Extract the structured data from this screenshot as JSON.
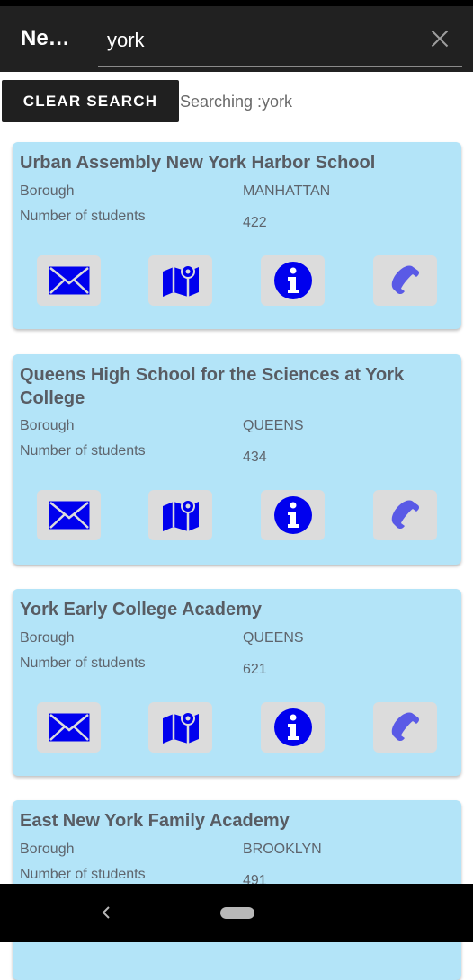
{
  "appbar": {
    "title": "Ne…",
    "search_value": "york"
  },
  "toolbar": {
    "clear_label": "CLEAR SEARCH",
    "status_text": "Searching :york"
  },
  "labels": {
    "borough": "Borough",
    "students": "Number of students"
  },
  "colors": {
    "card_bg": "#b3e4f8",
    "icon_blue": "#0000ee",
    "phone_blue": "#5a5ae6"
  },
  "schools": [
    {
      "name": "Urban Assembly New York Harbor School",
      "borough": "MANHATTAN",
      "students": "422"
    },
    {
      "name": "Queens High School for the Sciences at York College",
      "borough": "QUEENS",
      "students": "434"
    },
    {
      "name": "York Early College Academy",
      "borough": "QUEENS",
      "students": "621"
    },
    {
      "name": "East New York Family Academy",
      "borough": "BROOKLYN",
      "students": "491"
    }
  ],
  "actions": [
    "email-icon",
    "map-icon",
    "info-icon",
    "phone-icon"
  ]
}
